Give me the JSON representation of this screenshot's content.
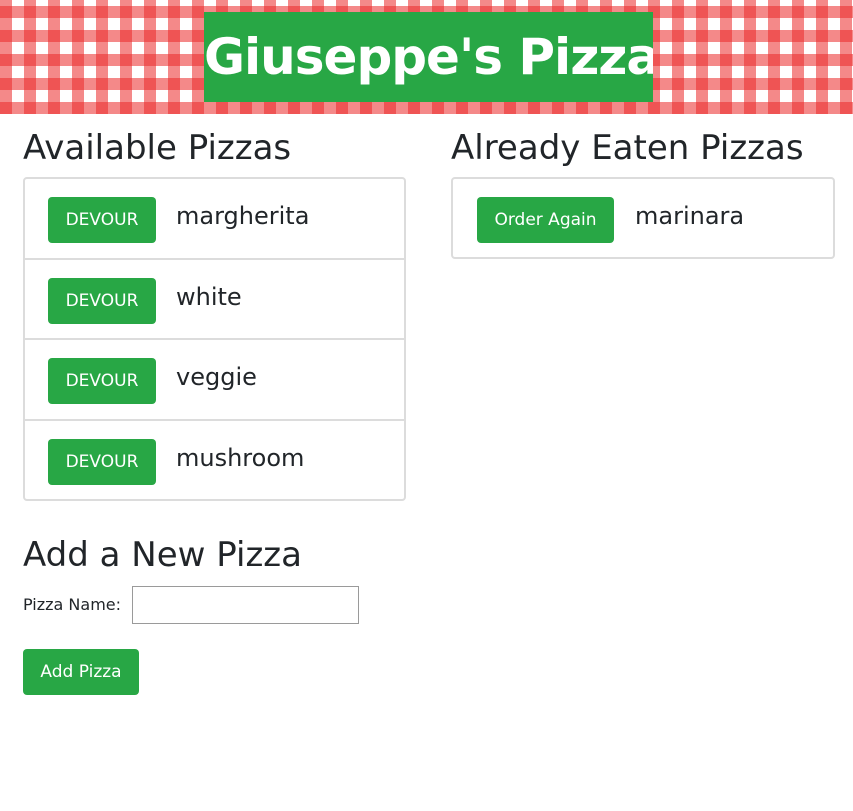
{
  "header": {
    "title": "Giuseppe's Pizza"
  },
  "available": {
    "title": "Available Pizzas",
    "button_label": "DEVOUR",
    "items": [
      {
        "name": "margherita"
      },
      {
        "name": "white"
      },
      {
        "name": "veggie"
      },
      {
        "name": "mushroom"
      }
    ]
  },
  "eaten": {
    "title": "Already Eaten Pizzas",
    "button_label": "Order Again",
    "items": [
      {
        "name": "marinara"
      }
    ]
  },
  "add_form": {
    "title": "Add a New Pizza",
    "field_label": "Pizza Name:",
    "field_value": "",
    "submit_label": "Add Pizza"
  },
  "colors": {
    "accent": "#28a745",
    "checker": "#eb2828",
    "text": "#212529",
    "border": "#dcdcdc"
  }
}
